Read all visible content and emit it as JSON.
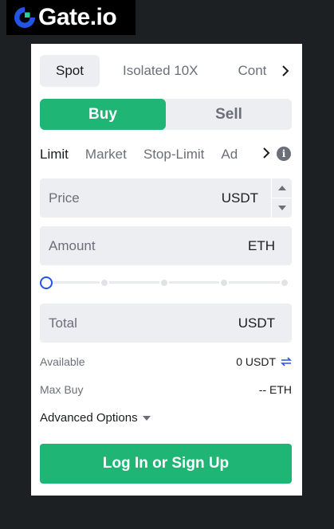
{
  "brand": {
    "name": "Gate.io",
    "accent": "#2354e6",
    "logo_icon": "gate-logo-icon"
  },
  "mode_tabs": [
    {
      "label": "Spot",
      "active": true
    },
    {
      "label": "Isolated 10X",
      "active": false
    },
    {
      "label": "Cont",
      "active": false
    }
  ],
  "side": {
    "buy_label": "Buy",
    "sell_label": "Sell",
    "selected": "Buy",
    "buy_color": "#1fb574"
  },
  "order_types": [
    {
      "label": "Limit",
      "active": true
    },
    {
      "label": "Market",
      "active": false
    },
    {
      "label": "Stop-Limit",
      "active": false
    },
    {
      "label": "Ad",
      "active": false
    }
  ],
  "price": {
    "placeholder": "Price",
    "unit": "USDT"
  },
  "amount": {
    "placeholder": "Amount",
    "unit": "ETH"
  },
  "slider": {
    "value_percent": 0,
    "steps": [
      0,
      25,
      50,
      75,
      100
    ]
  },
  "total": {
    "placeholder": "Total",
    "unit": "USDT"
  },
  "available": {
    "label": "Available",
    "value": "0 USDT",
    "icon": "transfer-icon"
  },
  "max_buy": {
    "label": "Max Buy",
    "value": "-- ETH"
  },
  "advanced": {
    "label": "Advanced Options"
  },
  "cta": {
    "label": "Log In or Sign Up"
  }
}
